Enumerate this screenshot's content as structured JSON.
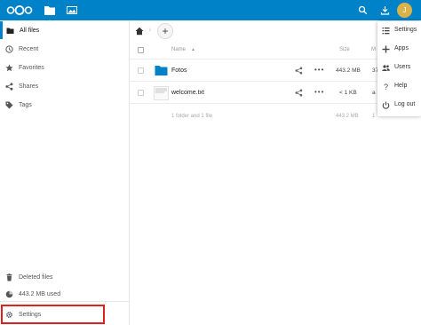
{
  "colors": {
    "brand": "#0082c9",
    "highlight": "#e0201f",
    "folder": "#0082c9",
    "avatar": "#d9b24a"
  },
  "topbar": {
    "logo": "nextcloud-logo",
    "apps": [
      {
        "icon": "folder-icon"
      },
      {
        "icon": "image-icon"
      }
    ],
    "avatar_letter": "J"
  },
  "sidebar": {
    "items": [
      {
        "label": "All files",
        "icon": "folder-icon"
      },
      {
        "label": "Recent",
        "icon": "clock-icon"
      },
      {
        "label": "Favorites",
        "icon": "star-icon"
      },
      {
        "label": "Shares",
        "icon": "share-icon"
      },
      {
        "label": "Tags",
        "icon": "tag-icon"
      }
    ],
    "deleted_files": "Deleted files",
    "quota": "443.2 MB used",
    "settings": "Settings"
  },
  "toolbar": {
    "add_label": "+"
  },
  "file_table": {
    "headers": {
      "name": "Name",
      "size": "Size",
      "modified": "M"
    },
    "rows": [
      {
        "name": "Fotos",
        "type": "folder",
        "size": "443.2 MB",
        "modified": "37"
      },
      {
        "name": "welcome.txt",
        "type": "file",
        "size": "< 1 KB",
        "modified": "a"
      }
    ],
    "summary": "1 folder and 1 file",
    "summary_size": "443.2 MB",
    "summary_modified": "1"
  },
  "user_menu": {
    "items": [
      {
        "label": "Settings",
        "icon": "gear-icon"
      },
      {
        "label": "Apps",
        "icon": "plus-icon"
      },
      {
        "label": "Users",
        "icon": "users-icon"
      },
      {
        "label": "Help",
        "icon": "help-icon"
      },
      {
        "label": "Log out",
        "icon": "power-icon"
      }
    ]
  }
}
